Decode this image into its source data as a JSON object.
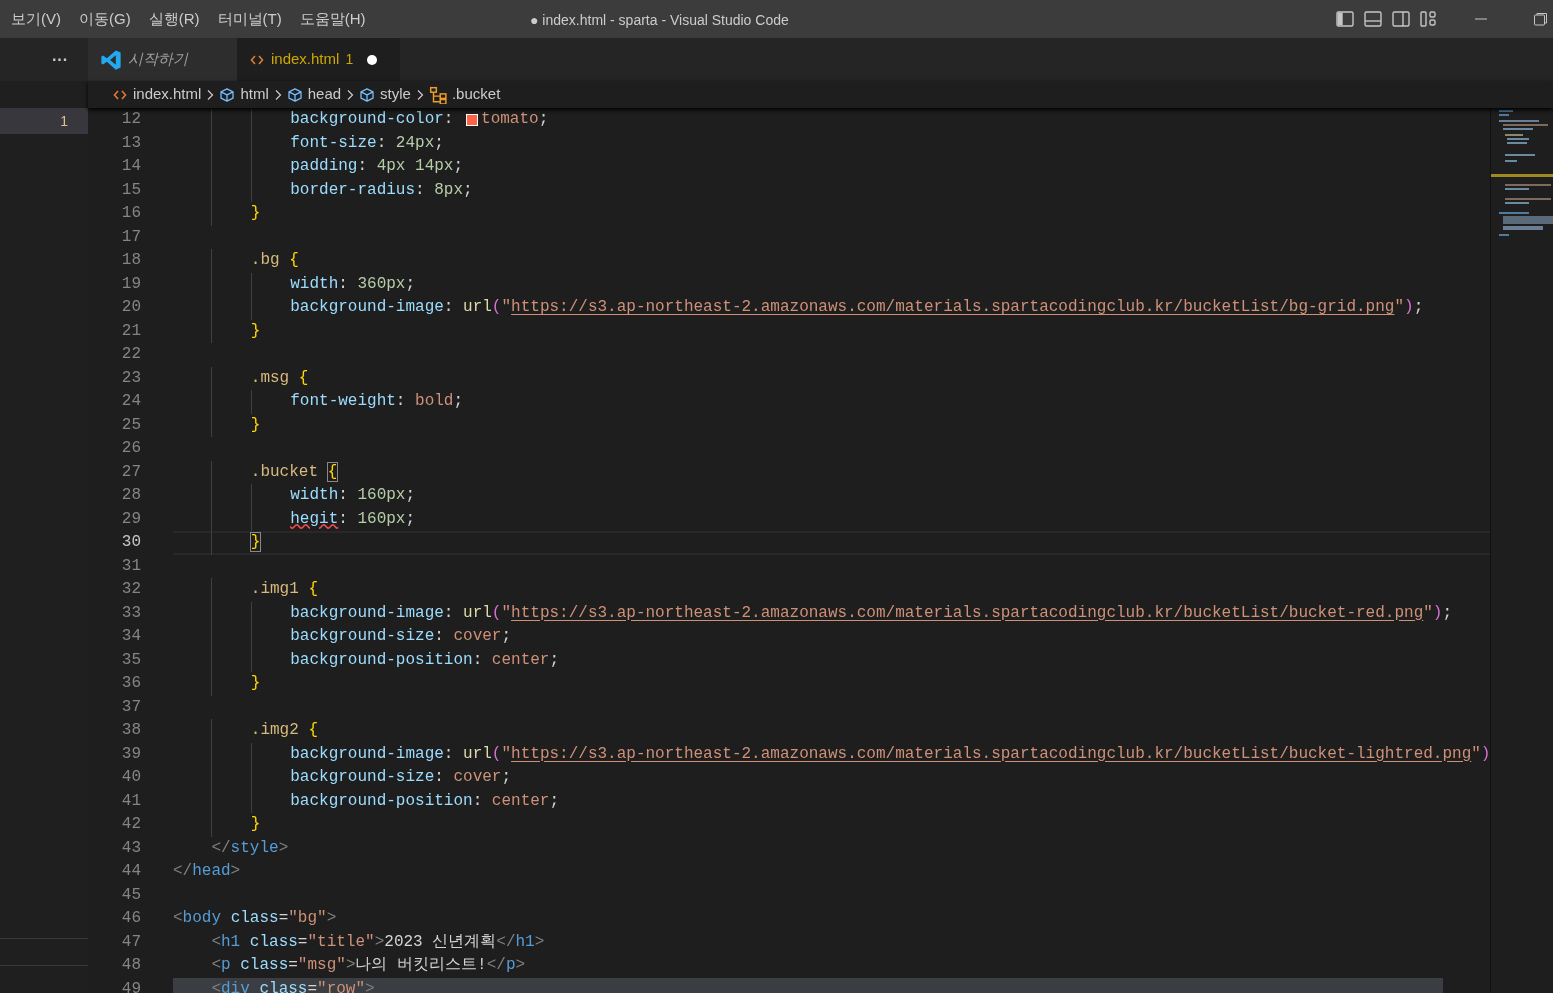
{
  "menu": [
    {
      "label": "보기(V)"
    },
    {
      "label": "이동(G)"
    },
    {
      "label": "실행(R)"
    },
    {
      "label": "터미널(T)"
    },
    {
      "label": "도움말(H)"
    }
  ],
  "window": {
    "title": "● index.html - sparta - Visual Studio Code"
  },
  "sidebar": {
    "more": "···",
    "items": [
      {
        "label": "1",
        "selected": true
      }
    ]
  },
  "tabs": [
    {
      "label": "시작하기",
      "kind": "app",
      "preview": true,
      "selected": false,
      "dirty": false
    },
    {
      "label": "index.html",
      "kind": "file",
      "preview": false,
      "selected": true,
      "problems": "1",
      "dirty": true
    }
  ],
  "breadcrumbs": [
    {
      "label": "index.html",
      "kind": "file"
    },
    {
      "label": "html",
      "kind": "element"
    },
    {
      "label": "head",
      "kind": "element"
    },
    {
      "label": "style",
      "kind": "element"
    },
    {
      "label": ".bucket",
      "kind": "selector"
    }
  ],
  "editor": {
    "lines": [
      {
        "number": "12",
        "kind": "code",
        "text": "            background-color: tomato;",
        "color": "#ff6347"
      },
      {
        "number": "13",
        "kind": "code",
        "text": "            font-size: 24px;"
      },
      {
        "number": "14",
        "kind": "code",
        "text": "            padding: 4px 14px;"
      },
      {
        "number": "15",
        "kind": "code",
        "text": "            border-radius: 8px;"
      },
      {
        "number": "16",
        "kind": "code",
        "text": "        }"
      },
      {
        "number": "17",
        "kind": "code"
      },
      {
        "number": "18",
        "kind": "code",
        "text": "        .bg {"
      },
      {
        "number": "19",
        "kind": "code",
        "text": "            width: 360px;"
      },
      {
        "number": "20",
        "kind": "code",
        "text": "            background-image: url(\"https://s3.ap-northeast-2.amazonaws.com/materials.spartacodingclub.kr/bucketList/bg-grid.png\");"
      },
      {
        "number": "21",
        "kind": "code",
        "text": "        }"
      },
      {
        "number": "22",
        "kind": "code"
      },
      {
        "number": "23",
        "kind": "code",
        "text": "        .msg {"
      },
      {
        "number": "24",
        "kind": "code",
        "text": "            font-weight: bold;"
      },
      {
        "number": "25",
        "kind": "code",
        "text": "        }"
      },
      {
        "number": "26",
        "kind": "code"
      },
      {
        "number": "27",
        "kind": "match",
        "text": "        .bucket {"
      },
      {
        "number": "28",
        "kind": "code",
        "text": "            width: 160px;"
      },
      {
        "number": "29",
        "kind": "error",
        "text": "            hegit: 160px;"
      },
      {
        "number": "30",
        "kind": "cursor",
        "text": "        }"
      },
      {
        "number": "31",
        "kind": "code"
      },
      {
        "number": "32",
        "kind": "code",
        "text": "        .img1 {"
      },
      {
        "number": "33",
        "kind": "code",
        "text": "            background-image: url(\"https://s3.ap-northeast-2.amazonaws.com/materials.spartacodingclub.kr/bucketList/bucket-red.png\");"
      },
      {
        "number": "34",
        "kind": "code",
        "text": "            background-size: cover;"
      },
      {
        "number": "35",
        "kind": "code",
        "text": "            background-position: center;"
      },
      {
        "number": "36",
        "kind": "code",
        "text": "        }"
      },
      {
        "number": "37",
        "kind": "code"
      },
      {
        "number": "38",
        "kind": "code",
        "text": "        .img2 {"
      },
      {
        "number": "39",
        "kind": "code",
        "text": "            background-image: url(\"https://s3.ap-northeast-2.amazonaws.com/materials.spartacodingclub.kr/bucketList/bucket-lightred.png\")"
      },
      {
        "number": "40",
        "kind": "code",
        "text": "            background-size: cover;"
      },
      {
        "number": "41",
        "kind": "code",
        "text": "            background-position: center;"
      },
      {
        "number": "42",
        "kind": "code",
        "text": "        }"
      },
      {
        "number": "43",
        "kind": "code",
        "text": "    </style>"
      },
      {
        "number": "44",
        "kind": "code",
        "text": "</head>"
      },
      {
        "number": "45",
        "kind": "code"
      },
      {
        "number": "46",
        "kind": "code",
        "text": "<body class=\"bg\">"
      },
      {
        "number": "47",
        "kind": "code",
        "text": "    <h1 class=\"title\">2023 신년계획</h1>"
      },
      {
        "number": "48",
        "kind": "code",
        "text": "    <p class=\"msg\">나의 버킷리스트!</p>"
      },
      {
        "number": "49",
        "kind": "highlight",
        "text": "    <div class=\"row\">"
      }
    ]
  }
}
